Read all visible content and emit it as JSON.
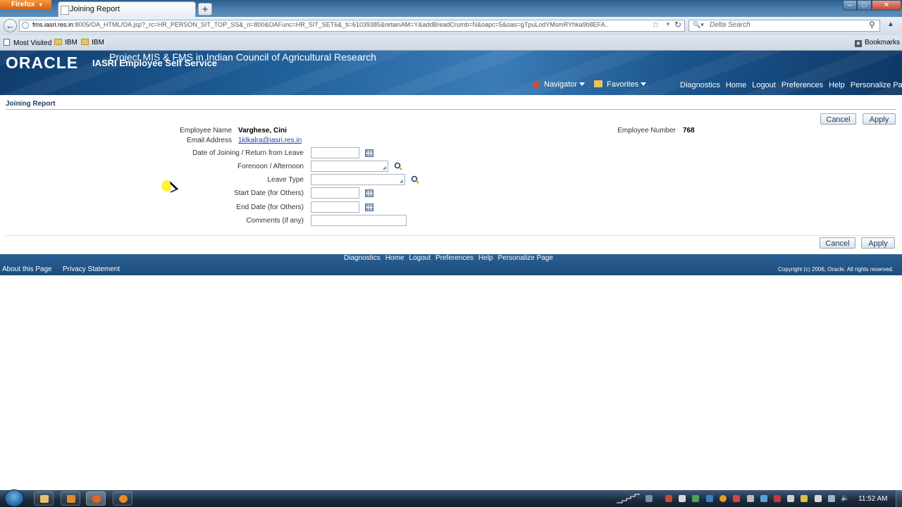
{
  "browser": {
    "menu_label": "Firefox",
    "tab_title": "Joining Report",
    "new_tab": "+",
    "url_host": "fms.iasri.res.in",
    "url_rest": ":8005/OA_HTML/OA.jsp?_rc=HR_PERSON_SIT_TOP_SS&_ri=800&OAFunc=HR_SIT_SET6&_ti=61039385&retainAM=Y&addBreadCrumb=N&oapc=5&oas=gTpuLodYMsmRYhka9b8EFA..",
    "search_placeholder": "Delta Search",
    "bookmarks": [
      "Most Visited",
      "IBM",
      "IBM"
    ],
    "bookmarks_menu": "Bookmarks"
  },
  "oracle": {
    "logo": "ORACLE",
    "app_title": "IASRI Employee Self Service",
    "project_title": "Project MIS & FMS in Indian Council of Agricultural Research",
    "navigator": "Navigator",
    "favorites": "Favorites",
    "global_links": [
      "Diagnostics",
      "Home",
      "Logout",
      "Preferences",
      "Help",
      "Personalize Page"
    ]
  },
  "page": {
    "title": "Joining Report",
    "cancel": "Cancel",
    "apply": "Apply",
    "employee_name_label": "Employee Name",
    "employee_name": "Varghese, Cini",
    "email_label": "Email Address",
    "email": "1klkalra@iasri.res.in",
    "employee_number_label": "Employee Number",
    "employee_number": "768",
    "fields": {
      "joining_date": "Date of Joining / Return from Leave",
      "session": "Forenoon / Afternoon",
      "leave_type": "Leave Type",
      "start_date": "Start Date (for Others)",
      "end_date": "End Date (for Others)",
      "comments": "Comments (if any)"
    }
  },
  "footer": {
    "links": [
      "Diagnostics",
      "Home",
      "Logout",
      "Preferences",
      "Help",
      "Personalize Page"
    ],
    "about": "About this Page",
    "privacy": "Privacy Statement",
    "copyright": "Copyright (c) 2006, Oracle. All rights reserved."
  },
  "taskbar": {
    "clock": "11:52 AM"
  }
}
